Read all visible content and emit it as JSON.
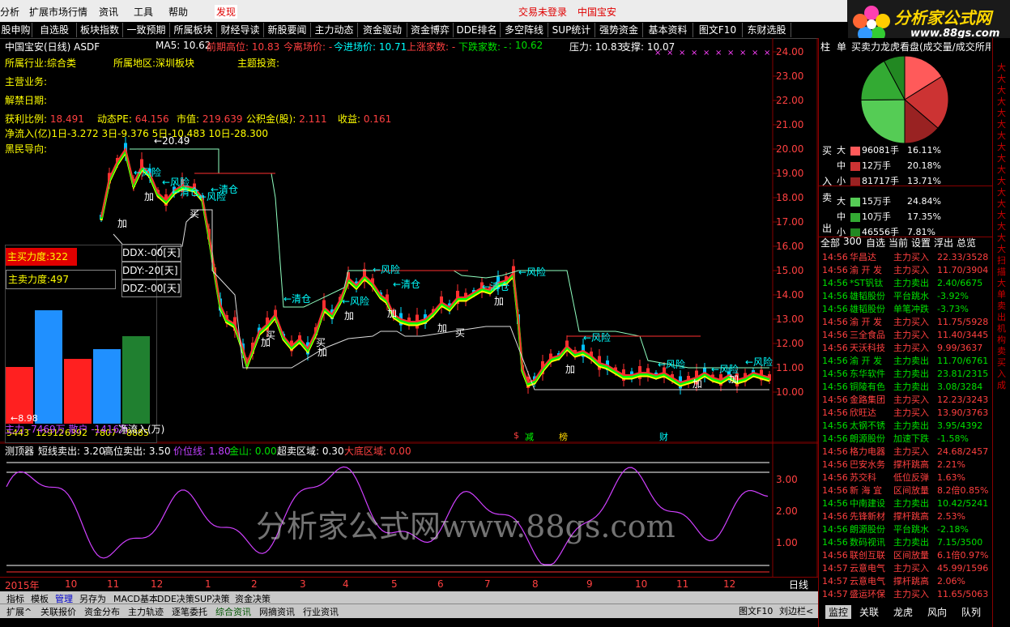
{
  "menubar": {
    "items": [
      "分析",
      "扩展市场行情",
      "资讯",
      "工具",
      "帮助",
      "发现"
    ],
    "status_left": "交易未登录",
    "status_right": "中国宝安"
  },
  "logo": {
    "text": "分析家公式网",
    "url": "www.88gs.com"
  },
  "toolbar": {
    "buttons": [
      "股申购",
      "自选股",
      "板块指数",
      "一致预期",
      "所属板块",
      "财经导读",
      "新股要闻",
      "主力动态",
      "资金驱动",
      "资金博弈",
      "DDE排名",
      "多空阵线",
      "SUP统计",
      "强势资金",
      "基本资料",
      "图文F10",
      "东财选股"
    ]
  },
  "chart_header": {
    "stock": "中国宝安(日线) ASDF",
    "ma5": "MA5: 10.62",
    "prev_high": "前期高位: 10.83",
    "today_open": "今离场价: -",
    "today_enter": "今进场价: 10.71",
    "up_count": "上涨家数: -",
    "down_count": "下跌家数: -",
    "val": ": 10.62",
    "pressure": "压力: 10.83",
    "support": "支撑: 10.07"
  },
  "info": {
    "industry_label": "所属行业:",
    "industry": "综合类",
    "region_label": "所属地区:",
    "region": "深圳板块",
    "theme_label": "主题投资:",
    "main_biz": "主营业务:",
    "unlock": "解禁日期:",
    "pe_label": "获利比例:",
    "pe": "18.491",
    "dyn_pe_label": "动态PE:",
    "dyn_pe": "64.156",
    "mcap_label": "市值:",
    "mcap": "219.639",
    "fund_label": "公积金(股):",
    "fund": "2.111",
    "eps_label": "收益:",
    "eps": "0.161",
    "netflow": "净流入(亿)1日-3.272 3日-9.376 5日-10.483 10日-28.300",
    "guide": "黑民导向:"
  },
  "annotations": {
    "peak": "20.49",
    "low": "8.98",
    "risk": "风险",
    "clear": "清仓",
    "add": "加",
    "buy": "买"
  },
  "ddx": {
    "buy_power": "主买力度:322",
    "sell_power": "主卖力度:497",
    "ddx": "DDX:-00[天]",
    "ddy": "DDY:-20[天]",
    "ddz": "DDZ:-00[天]",
    "bars": [
      "5443",
      "12912",
      "6392",
      "7807",
      "-8885"
    ],
    "bottom": "主力 -7469万  散户 -1416万",
    "inflow_label": "净流入(万)"
  },
  "event_marks": [
    "减",
    "榜",
    "财"
  ],
  "y_axis": [
    "24.00",
    "23.00",
    "22.00",
    "21.00",
    "20.00",
    "19.00",
    "18.00",
    "17.00",
    "16.00",
    "15.00",
    "14.00",
    "13.00",
    "12.00",
    "11.00",
    "10.00"
  ],
  "sub_header": {
    "name": "测顶器",
    "short_sell": "短线卖出: 3.20",
    "high_sell": "高位卖出: 3.50",
    "price_line": "价位线: 1.80",
    "gold": "金山: 0.00",
    "overbuy": "超卖区域: 0.30",
    "bottom": "大底区域: 0.00"
  },
  "sub_y_axis": [
    "3.00",
    "2.00",
    "1.00"
  ],
  "watermark": "分析家公式网www.88gs.com",
  "x_axis": [
    "2015年",
    "10",
    "11",
    "12",
    "1",
    "2",
    "3",
    "4",
    "5",
    "6",
    "7",
    "8",
    "9",
    "10",
    "11",
    "12"
  ],
  "x_axis_right": "日线",
  "bottom_tabs1": [
    "指标",
    "模板",
    "管理",
    "另存为",
    "MACD基本",
    "DDE决策",
    "SUP决策",
    "资金决策"
  ],
  "bottom_tabs2": [
    "扩展^",
    "关联报价",
    "资金分布",
    "主力轨迹",
    "逐笔委托",
    "综合资讯",
    "网摘资讯",
    "行业资讯"
  ],
  "bottom_right": [
    "图文F10",
    "|",
    "刘边栏<"
  ],
  "right_panel": {
    "tabs": [
      "柱",
      "单"
    ],
    "title": "买卖力龙虎看盘(成交量/成交所用)",
    "pie": [
      {
        "label": "大",
        "color": "#ff5a5a",
        "value": "96081手",
        "pct": "16.11%",
        "side": "买"
      },
      {
        "label": "中",
        "color": "#cc3333",
        "value": "12万手",
        "pct": "20.18%",
        "side": "买"
      },
      {
        "label": "小",
        "color": "#992222",
        "value": "81717手",
        "pct": "13.71%",
        "side": "买"
      },
      {
        "label": "大",
        "color": "#55cc55",
        "value": "15万手",
        "pct": "24.84%",
        "side": "卖"
      },
      {
        "label": "中",
        "color": "#33aa33",
        "value": "10万手",
        "pct": "17.35%",
        "side": "卖"
      },
      {
        "label": "小",
        "color": "#228822",
        "value": "46556手",
        "pct": "7.81%",
        "side": "卖"
      }
    ],
    "side_labels": [
      "买",
      "入",
      "卖",
      "出"
    ],
    "filter_tabs": [
      "全部",
      "300",
      "自选",
      "当前",
      "设置",
      "浮出",
      "总览"
    ],
    "rows": [
      {
        "t": "14:56",
        "n": "华昌达",
        "a": "主力买入",
        "v": "22.33/3528",
        "c": "red"
      },
      {
        "t": "14:56",
        "n": "渝 开 发",
        "a": "主力买入",
        "v": "11.70/3904",
        "c": "red"
      },
      {
        "t": "14:56",
        "n": "*ST钒钛",
        "a": "主力卖出",
        "v": "2.40/6675",
        "c": "green"
      },
      {
        "t": "14:56",
        "n": "雄韬股份",
        "a": "平台跳水",
        "v": "-3.92%",
        "c": "green"
      },
      {
        "t": "14:56",
        "n": "雄韬股份",
        "a": "单笔冲跌",
        "v": "-3.73%",
        "c": "green"
      },
      {
        "t": "14:56",
        "n": "渝 开 发",
        "a": "主力买入",
        "v": "11.75/5928",
        "c": "red"
      },
      {
        "t": "14:56",
        "n": "三全食品",
        "a": "主力买入",
        "v": "11.40/3445",
        "c": "red"
      },
      {
        "t": "14:56",
        "n": "天沃科技",
        "a": "主力买入",
        "v": "9.99/3637",
        "c": "red"
      },
      {
        "t": "14:56",
        "n": "渝 开 发",
        "a": "主力卖出",
        "v": "11.70/6761",
        "c": "green"
      },
      {
        "t": "14:56",
        "n": "东华软件",
        "a": "主力卖出",
        "v": "23.81/2315",
        "c": "green"
      },
      {
        "t": "14:56",
        "n": "铜陵有色",
        "a": "主力卖出",
        "v": "3.08/3284",
        "c": "green"
      },
      {
        "t": "14:56",
        "n": "金路集团",
        "a": "主力买入",
        "v": "12.23/3243",
        "c": "red"
      },
      {
        "t": "14:56",
        "n": "欣旺达",
        "a": "主力买入",
        "v": "13.90/3763",
        "c": "red"
      },
      {
        "t": "14:56",
        "n": "太钢不锈",
        "a": "主力卖出",
        "v": "3.95/4392",
        "c": "green"
      },
      {
        "t": "14:56",
        "n": "朗源股份",
        "a": "加速下跌",
        "v": "-1.58%",
        "c": "green"
      },
      {
        "t": "14:56",
        "n": "格力电器",
        "a": "主力买入",
        "v": "24.68/2457",
        "c": "red"
      },
      {
        "t": "14:56",
        "n": "巴安水务",
        "a": "撑杆跳高",
        "v": "2.21%",
        "c": "red"
      },
      {
        "t": "14:56",
        "n": "苏交科",
        "a": "低位反弹",
        "v": "1.63%",
        "c": "red"
      },
      {
        "t": "14:56",
        "n": "新 海 宜",
        "a": "区间放量",
        "v": "8.2倍0.85%",
        "c": "red"
      },
      {
        "t": "14:56",
        "n": "中南建设",
        "a": "主力卖出",
        "v": "10.42/5241",
        "c": "green"
      },
      {
        "t": "14:56",
        "n": "先锋新材",
        "a": "撑杆跳高",
        "v": "2.53%",
        "c": "red"
      },
      {
        "t": "14:56",
        "n": "朗源股份",
        "a": "平台跳水",
        "v": "-2.18%",
        "c": "green"
      },
      {
        "t": "14:56",
        "n": "数码视讯",
        "a": "主力卖出",
        "v": "7.15/3500",
        "c": "green"
      },
      {
        "t": "14:56",
        "n": "联创互联",
        "a": "区间放量",
        "v": "6.1倍0.97%",
        "c": "red"
      },
      {
        "t": "14:57",
        "n": "云意电气",
        "a": "主力买入",
        "v": "45.99/1596",
        "c": "red"
      },
      {
        "t": "14:57",
        "n": "云意电气",
        "a": "撑杆跳高",
        "v": "2.06%",
        "c": "red"
      },
      {
        "t": "14:57",
        "n": "盛运环保",
        "a": "主力买入",
        "v": "11.65/5063",
        "c": "red"
      }
    ],
    "bottom_tabs": [
      "监控",
      "关联",
      "龙虎",
      "风向",
      "队列"
    ]
  },
  "right_edge_text": "大大大大大大大大大大大大大大大大大扫描大单卖出机构卖买入成"
}
